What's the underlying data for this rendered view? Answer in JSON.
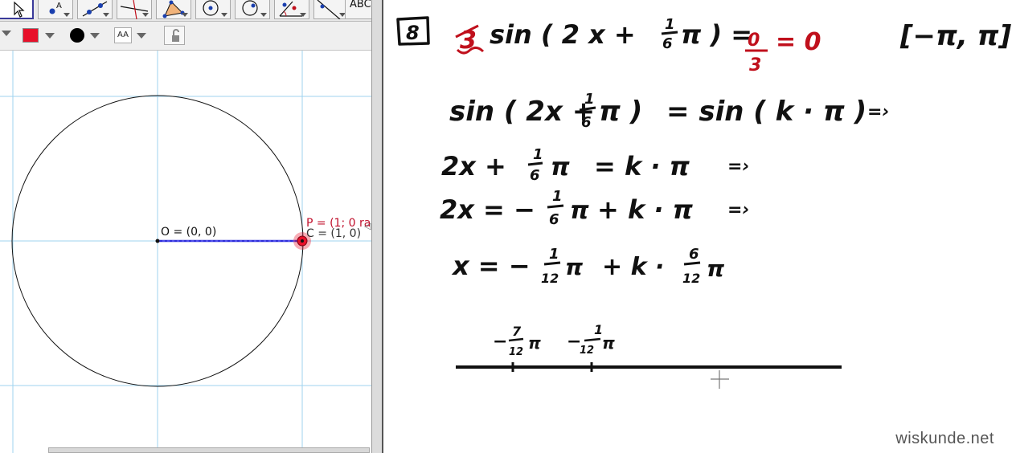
{
  "geogebra": {
    "toolbar": {
      "tools": [
        {
          "name": "move-tool-icon"
        },
        {
          "name": "point-tool-icon"
        },
        {
          "name": "line-tool-icon"
        },
        {
          "name": "perpendicular-tool-icon"
        },
        {
          "name": "polygon-tool-icon"
        },
        {
          "name": "circle-tool-icon"
        },
        {
          "name": "circle-through-point-icon"
        },
        {
          "name": "angle-tool-icon"
        },
        {
          "name": "reflect-tool-icon"
        },
        {
          "name": "text-tool-icon",
          "label": "ABC"
        }
      ]
    },
    "stylebar": {
      "color": "#e8102a",
      "point_style": "#000000",
      "text_size_label": "AA"
    },
    "graphics": {
      "origin_label": "O = (0, 0)",
      "point_c_label": "C = (1, 0)",
      "point_p_label": "P = (1; 0 ra",
      "segment_color": "#2a2ad8",
      "point_p_color": "#e8102a",
      "grid_color": "#9fd3ef"
    }
  },
  "whiteboard": {
    "problem_number": "8",
    "line1_main": "sin ( 2 x +  ",
    "line1_frac_num": "1",
    "line1_frac_den": "6",
    "line1_pi": "π ) =",
    "line1_rhs_num": "0",
    "line1_rhs_den": "3",
    "line1_result": "= 0",
    "coef_crossed": "3",
    "interval": "[−π, π]",
    "line2": {
      "left": "sin ( 2x +",
      "num": "1",
      "den": "6",
      "pi": "π )",
      "right": "= sin ( k · π )",
      "arrow": "=›"
    },
    "line3": {
      "left": "2x +",
      "num": "1",
      "den": "6",
      "pi": "π",
      "right": "= k · π",
      "arrow": "=›"
    },
    "line4": {
      "left": "2x = −",
      "num": "1",
      "den": "6",
      "pi": "π",
      "right": "+ k · π",
      "arrow": "=›"
    },
    "line5": {
      "left": "x = −",
      "num1": "1",
      "den1": "12",
      "pi1": "π",
      "mid": "+ k ·",
      "num2": "6",
      "den2": "12",
      "pi2": "π"
    },
    "numberline": {
      "mark1": {
        "sign": "−",
        "num": "7",
        "den": "12",
        "pi": "π"
      },
      "mark2": {
        "sign": "−",
        "num": "1",
        "den": "12",
        "pi": "π"
      }
    },
    "watermark": "wiskunde.net"
  }
}
